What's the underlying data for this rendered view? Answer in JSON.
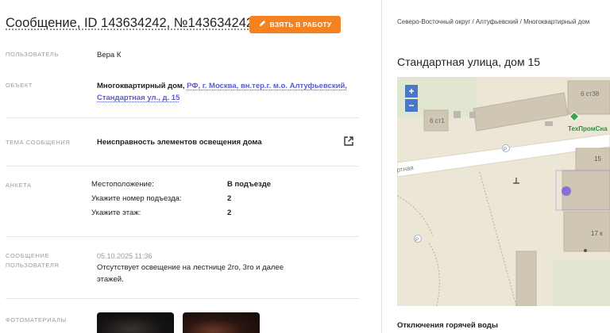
{
  "header": {
    "title": "Сообщение, ID 143634242, №143634242",
    "collapse_icon": "chevron-up-icon",
    "take_button": "ВЗЯТЬ В РАБОТУ",
    "take_button_icon": "pencil-icon"
  },
  "fields": {
    "user": {
      "label": "ПОЛЬЗОВАТЕЛЬ",
      "value": "Вера К"
    },
    "object": {
      "label": "ОБЪЕКТ",
      "type": "Многоквартирный дом,",
      "address": "РФ, г. Москва, вн.тер.г. м.о. Алтуфьевский, Стандартная ул., д. 15"
    },
    "topic": {
      "label": "ТЕМА СООБЩЕНИЯ",
      "value": "Неисправность элементов освещения дома",
      "icon": "external-link-icon"
    },
    "survey": {
      "label": "АНКЕТА",
      "rows": [
        {
          "key": "Местоположение:",
          "value": "В подъезде"
        },
        {
          "key": "Укажите номер подъезда:",
          "value": "2"
        },
        {
          "key": "Укажите этаж:",
          "value": "2"
        }
      ]
    },
    "message": {
      "label": "СООБЩЕНИЕ ПОЛЬЗОВАТЕЛЯ",
      "date": "05.10.2025 11:36",
      "text": "Отсутствует освещение на лестнице 2го, 3го и далее этажей."
    },
    "photos": {
      "label": "ФОТОМАТЕРИАЛЫ"
    }
  },
  "right": {
    "breadcrumb": "Северо-Восточный округ / Алтуфьевский / Многоквартирный дом",
    "address": "Стандартная улица, дом 15",
    "map": {
      "zoom_in": "+",
      "zoom_out": "−",
      "labels": {
        "b1": "6 ст1",
        "b2": "6 ст38",
        "poi": "ТехПромСна",
        "street": "ртная",
        "b3": "15",
        "b4": "17 к",
        "p1": "P",
        "p2": "P"
      }
    },
    "outage_title": "Отключения горячей воды"
  },
  "colors": {
    "accent": "#f58220",
    "link": "#5b5bd6",
    "map_marker": "#8a70d6"
  }
}
